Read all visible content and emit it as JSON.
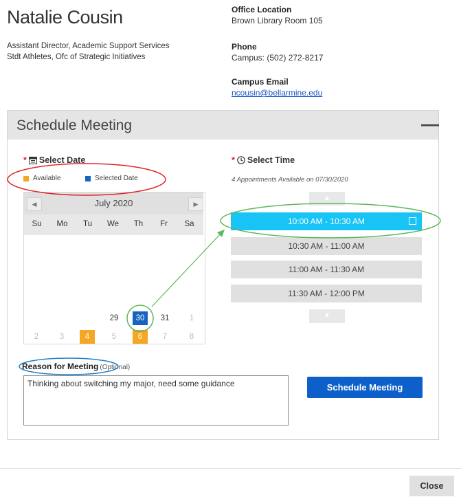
{
  "profile": {
    "name": "Natalie Cousin",
    "title_line1": "Assistant Director, Academic Support Services",
    "title_line2": "Stdt Athletes, Ofc of Strategic Initiatives"
  },
  "contact": {
    "office_label": "Office Location",
    "office_value": "Brown Library Room 105",
    "phone_label": "Phone",
    "phone_value": "Campus: (502) 272-8217",
    "email_label": "Campus Email",
    "email_value": "ncousin@bellarmine.edu"
  },
  "panel": {
    "title": "Schedule Meeting",
    "collapse_icon": "minus-icon"
  },
  "date_section": {
    "required_mark": "*",
    "label": "Select Date",
    "icon": "calendar-icon",
    "legend": [
      {
        "label": "Available",
        "color": "#f5a623"
      },
      {
        "label": "Selected Date",
        "color": "#1565c0"
      }
    ]
  },
  "calendar": {
    "month": "July 2020",
    "prev_icon": "chevron-left-icon",
    "next_icon": "chevron-right-icon",
    "weekdays": [
      "Su",
      "Mo",
      "Tu",
      "We",
      "Th",
      "Fr",
      "Sa"
    ],
    "visible_days": [
      {
        "day": "29",
        "state": "normal"
      },
      {
        "day": "30",
        "state": "selected"
      },
      {
        "day": "31",
        "state": "normal"
      },
      {
        "day": "1",
        "state": "muted"
      },
      {
        "day": "2",
        "state": "muted"
      },
      {
        "day": "3",
        "state": "muted"
      },
      {
        "day": "4",
        "state": "available"
      },
      {
        "day": "5",
        "state": "muted"
      },
      {
        "day": "6",
        "state": "available"
      },
      {
        "day": "7",
        "state": "muted"
      },
      {
        "day": "8",
        "state": "muted"
      }
    ]
  },
  "time_section": {
    "required_mark": "*",
    "label": "Select Time",
    "icon": "clock-icon",
    "availability_note": "4 Appointments Available on 07/30/2020",
    "up_icon": "chevron-up-icon",
    "down_icon": "chevron-down-icon",
    "slots": [
      {
        "label": "10:00 AM - 10:30 AM",
        "selected": true
      },
      {
        "label": "10:30 AM - 11:00 AM",
        "selected": false
      },
      {
        "label": "11:00 AM - 11:30 AM",
        "selected": false
      },
      {
        "label": "11:30 AM - 12:00 PM",
        "selected": false
      }
    ]
  },
  "reason": {
    "label": "Reason for Meeting",
    "optional": "(Optional)",
    "value": "Thinking about switching my major, need some guidance"
  },
  "actions": {
    "schedule_label": "Schedule Meeting",
    "close_label": "Close"
  },
  "colors": {
    "accent_blue": "#0d5fc9",
    "selected_slot": "#18c3f5",
    "available": "#f5a623",
    "selected_date": "#1565c0",
    "annotation_red": "#e0242a",
    "annotation_green": "#5cb85c",
    "annotation_blue": "#1f7fc8"
  }
}
